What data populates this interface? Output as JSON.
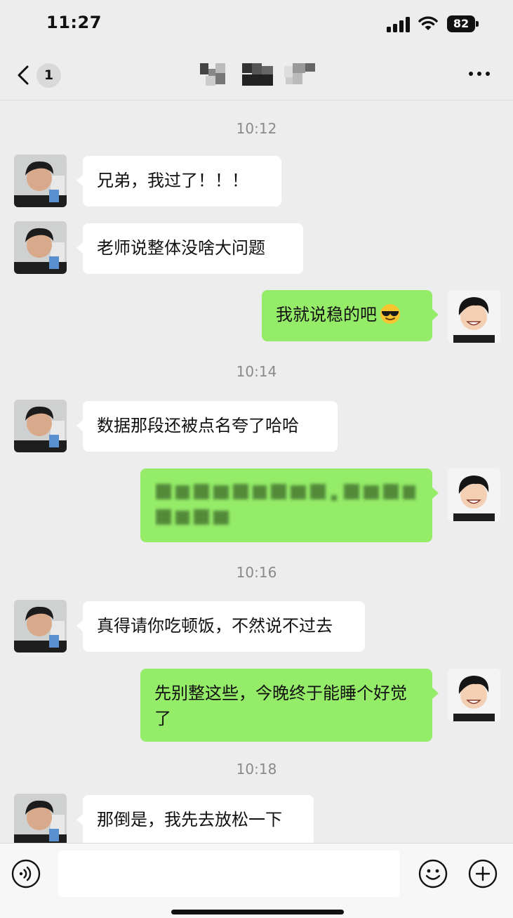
{
  "status_bar": {
    "time": "11:27",
    "battery": "82"
  },
  "nav": {
    "unread_count": "1",
    "title_mosaic": "pixelated-contact-name"
  },
  "chat": {
    "timestamps": [
      "10:12",
      "10:14",
      "10:16",
      "10:18"
    ],
    "messages": [
      {
        "from": "friend",
        "text": "兄弟，我过了！！！"
      },
      {
        "from": "friend",
        "text": "老师说整体没啥大问题"
      },
      {
        "from": "me",
        "text": "我就说稳的吧",
        "emoji": "sunglasses-emoji"
      },
      {
        "from": "friend",
        "text": "数据那段还被点名夸了哈哈"
      },
      {
        "from": "me",
        "text": "",
        "blurred": true
      },
      {
        "from": "friend",
        "text": "真得请你吃顿饭，不然说不过去"
      },
      {
        "from": "me",
        "text": "先别整这些，今晚终于能睡个好觉了"
      },
      {
        "from": "friend",
        "text": "那倒是，我先去放松一下"
      }
    ]
  },
  "input_bar": {
    "placeholder": ""
  },
  "icons": {
    "back": "chevron-left-icon",
    "more": "more-dots-icon",
    "voice": "voice-icon",
    "emoji": "smiley-icon",
    "plus": "plus-icon"
  },
  "colors": {
    "outgoing_bubble": "#95ec69",
    "incoming_bubble": "#ffffff",
    "background": "#ededed"
  }
}
